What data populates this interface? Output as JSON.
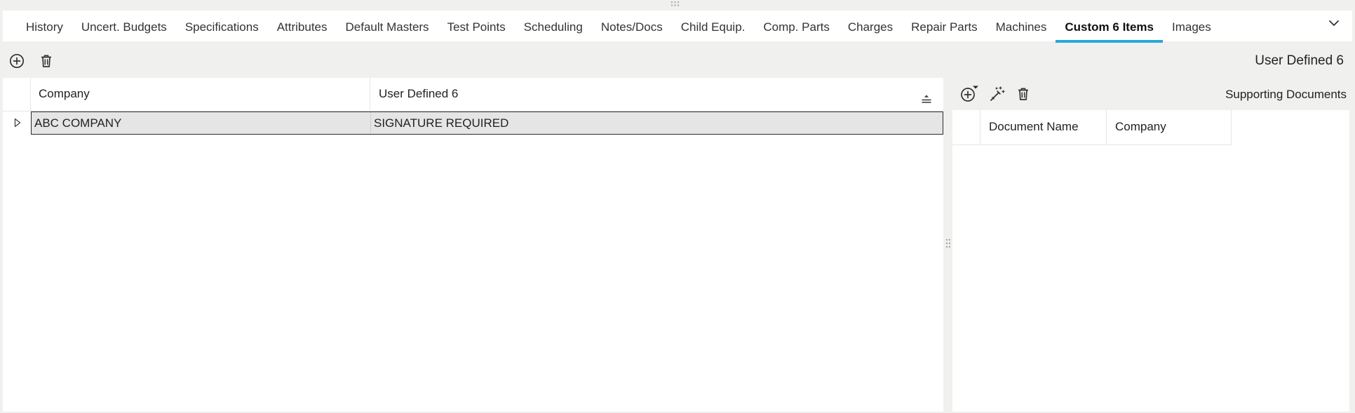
{
  "tabs": [
    {
      "label": "History",
      "active": false
    },
    {
      "label": "Uncert. Budgets",
      "active": false
    },
    {
      "label": "Specifications",
      "active": false
    },
    {
      "label": "Attributes",
      "active": false
    },
    {
      "label": "Default Masters",
      "active": false
    },
    {
      "label": "Test Points",
      "active": false
    },
    {
      "label": "Scheduling",
      "active": false
    },
    {
      "label": "Notes/Docs",
      "active": false
    },
    {
      "label": "Child Equip.",
      "active": false
    },
    {
      "label": "Comp. Parts",
      "active": false
    },
    {
      "label": "Charges",
      "active": false
    },
    {
      "label": "Repair Parts",
      "active": false
    },
    {
      "label": "Machines",
      "active": false
    },
    {
      "label": "Custom 6 Items",
      "active": true
    },
    {
      "label": "Images",
      "active": false
    }
  ],
  "colors": {
    "accent": "#29a8d8",
    "selected_row_bg": "#e5e5e5",
    "panel_bg": "#f0f0ef"
  },
  "icons": {
    "add": "plus-circle-icon",
    "delete": "trash-icon",
    "edit": "magic-wand-icon",
    "column_menu": "collapse-lines-icon",
    "expand_row": "triangle-right-icon",
    "tabs_overflow": "chevron-down-icon",
    "drag": "grip-dots-icon"
  },
  "main": {
    "section_title": "User Defined 6",
    "grid": {
      "columns": [
        "Company",
        "User Defined 6"
      ],
      "rows": [
        {
          "company": "ABC COMPANY",
          "user_defined_6": "SIGNATURE REQUIRED",
          "selected": true
        }
      ]
    }
  },
  "supporting": {
    "title": "Supporting Documents",
    "columns": [
      "Document Name",
      "Company"
    ],
    "rows": []
  }
}
